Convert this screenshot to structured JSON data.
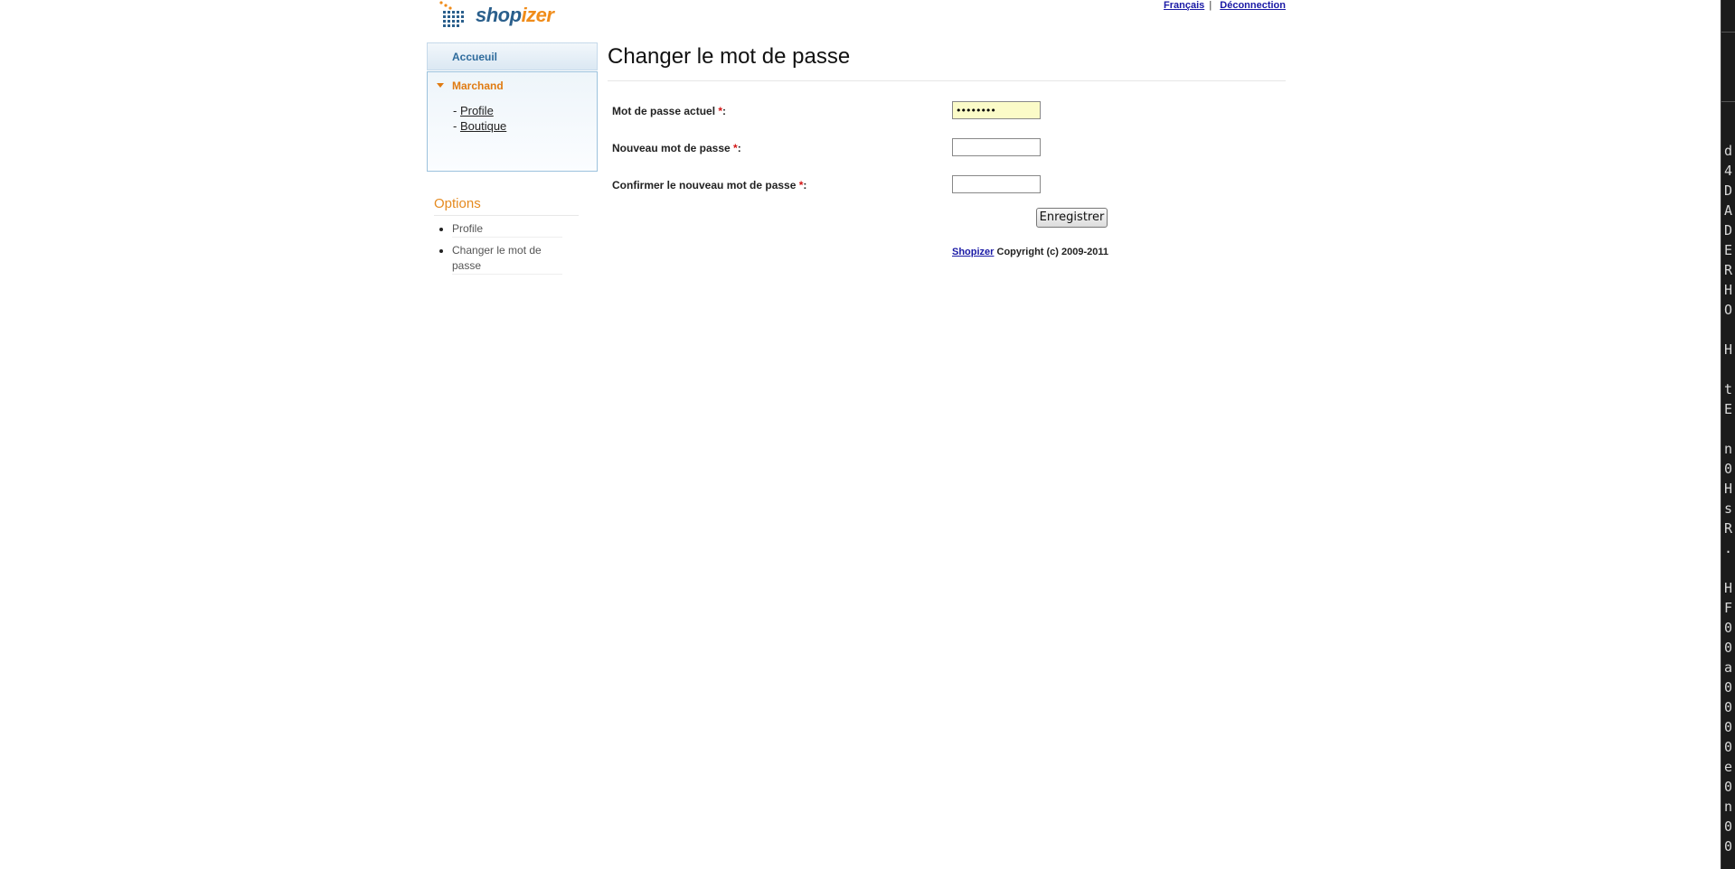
{
  "brand": {
    "logo_text_1": "shop",
    "logo_text_2": "izer"
  },
  "header": {
    "language_link": "Français",
    "separator": "|",
    "logout_link": "Déconnection"
  },
  "nav": {
    "home": "Accueuil",
    "merchant": {
      "label": "Marchand",
      "items": [
        {
          "prefix": "- ",
          "label": "Profile"
        },
        {
          "prefix": "- ",
          "label": "Boutique"
        }
      ]
    }
  },
  "options": {
    "title": "Options",
    "items": [
      "Profile",
      "Changer le mot de passe"
    ]
  },
  "main": {
    "title": "Changer le mot de passe",
    "fields": [
      {
        "label": "Mot de passe actuel ",
        "required": "*",
        "colon": ":",
        "value": "••••••••"
      },
      {
        "label": "Nouveau mot de passe ",
        "required": "*",
        "colon": ":",
        "value": ""
      },
      {
        "label": "Confirmer le nouveau mot de passe ",
        "required": "*",
        "colon": ":",
        "value": ""
      }
    ],
    "save_label": "Enregistrer"
  },
  "footer": {
    "link": "Shopizer",
    "text": " Copyright (c) 2009-2011"
  },
  "terminal": {
    "chars": [
      "d",
      "4",
      "D",
      "A",
      "D",
      "E",
      "R",
      "H",
      "O",
      "",
      "H",
      "",
      "t",
      "E",
      "",
      "n",
      "0",
      "H",
      "s",
      "R",
      ".",
      "",
      "H",
      "F",
      "0",
      "0",
      "a",
      "0",
      "0",
      "0",
      "0",
      "e",
      "0",
      "n",
      "0",
      "0"
    ]
  },
  "colors": {
    "accent_orange": "#e07b12",
    "link_blue": "#1a1aa6",
    "nav_blue": "#2e6b9c",
    "filled_field_bg": "#fbfbc8"
  }
}
